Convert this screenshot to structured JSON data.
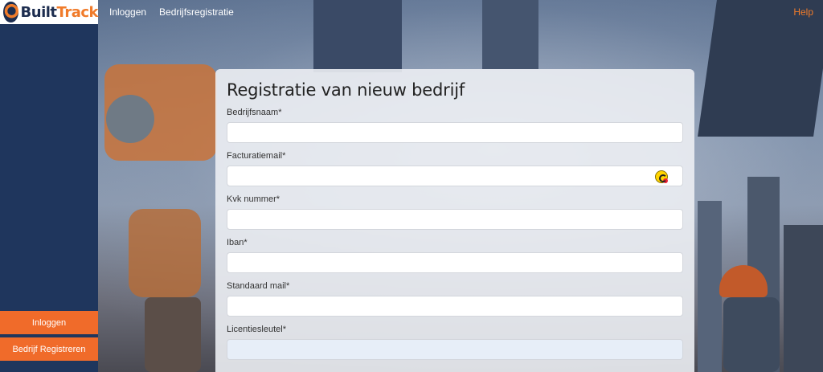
{
  "brand": {
    "name_part1": "Built",
    "name_part2": "Track"
  },
  "nav": {
    "links": [
      "Inloggen",
      "Bedrijfsregistratie"
    ],
    "help": "Help"
  },
  "sidebar": {
    "login": "Inloggen",
    "register": "Bedrijf Registreren"
  },
  "form": {
    "title": "Registratie van nieuw bedrijf",
    "fields": [
      {
        "label": "Bedrijfsnaam*",
        "value": ""
      },
      {
        "label": "Facturatiemail*",
        "value": ""
      },
      {
        "label": "Kvk nummer*",
        "value": ""
      },
      {
        "label": "Iban*",
        "value": ""
      },
      {
        "label": "Standaard mail*",
        "value": ""
      },
      {
        "label": "Licentiesleutel*",
        "value": ""
      }
    ]
  },
  "colors": {
    "accent": "#f06b2a",
    "sidebar": "#1f365d",
    "brand_dark": "#1d2d4f"
  }
}
